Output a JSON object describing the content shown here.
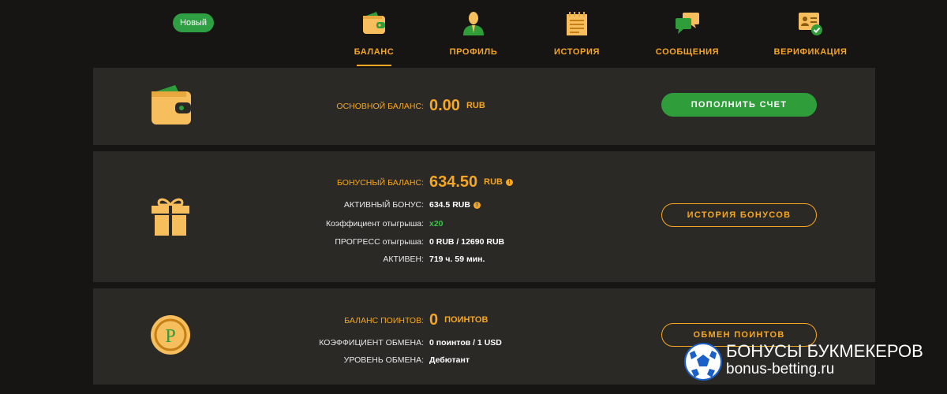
{
  "badge": {
    "label": "Новый"
  },
  "nav": [
    {
      "label": "БАЛАНС",
      "icon": "wallet-icon",
      "active": true
    },
    {
      "label": "ПРОФИЛЬ",
      "icon": "user-icon",
      "active": false
    },
    {
      "label": "ИСТОРИЯ",
      "icon": "document-icon",
      "active": false
    },
    {
      "label": "СООБЩЕНИЯ",
      "icon": "chat-icon",
      "active": false
    },
    {
      "label": "ВЕРИФИКАЦИЯ",
      "icon": "id-card-check-icon",
      "active": false
    }
  ],
  "main_balance": {
    "label": "ОСНОВНОЙ БАЛАНС:",
    "amount": "0.00",
    "currency": "RUB",
    "button": "ПОПОЛНИТЬ СЧЕТ"
  },
  "bonus": {
    "label": "БОНУСНЫЙ БАЛАНС:",
    "amount": "634.50",
    "currency": "RUB",
    "active_label": "АКТИВНЫЙ БОНУС:",
    "active_value": "634.5 RUB",
    "wager_label": "Коэффициент отыгрыша:",
    "wager_value": "x20",
    "progress_label": "ПРОГРЕСС отыгрыша:",
    "progress_value": "0 RUB / 12690 RUB",
    "time_label": "АКТИВЕН:",
    "time_value": "719 ч. 59 мин.",
    "button": "ИСТОРИЯ БОНУСОВ"
  },
  "points": {
    "label": "БАЛАНС ПОИНТОВ:",
    "amount": "0",
    "unit": "ПОИНТОВ",
    "rate_label": "КОЭФФИЦИЕНТ ОБМЕНА:",
    "rate_value": "0 поинтов / 1 USD",
    "level_label": "УРОВЕНЬ ОБМЕНА:",
    "level_value": "Дебютант",
    "button": "ОБМЕН ПОИНТОВ",
    "coin_letter": "P"
  },
  "watermark": {
    "line1": "БОНУСЫ БУКМЕКЕРОВ",
    "line2": "bonus-betting.ru"
  },
  "colors": {
    "accent": "#f5a623",
    "green": "#2e9d3a",
    "panel": "#2a2926",
    "background": "#161513"
  }
}
